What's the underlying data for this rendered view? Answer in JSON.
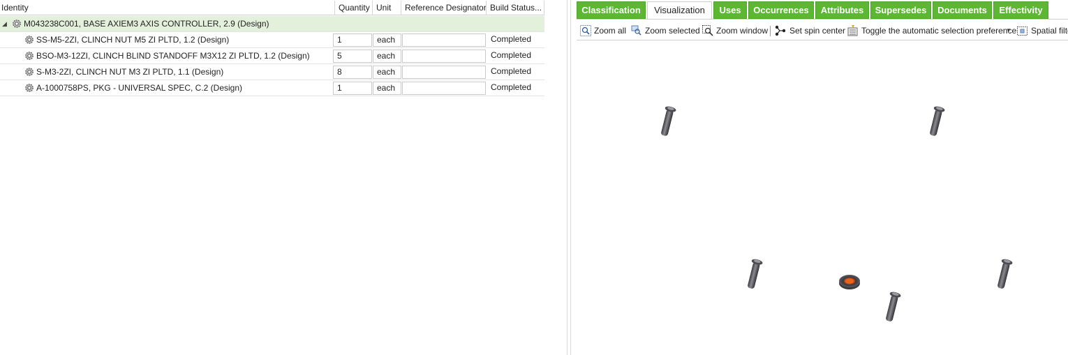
{
  "grid": {
    "columns": [
      "Identity",
      "Quantity",
      "Unit",
      "Reference Designator",
      "Build Status..."
    ],
    "rows": [
      {
        "identity": "M043238C001, BASE AXIEM3 AXIS CONTROLLER, 2.9 (Design)",
        "quantity": "",
        "unit": "",
        "ref": "",
        "status": ""
      },
      {
        "identity": "SS-M5-2ZI, CLINCH NUT M5 ZI PLTD, 1.2 (Design)",
        "quantity": "1",
        "unit": "each",
        "ref": "",
        "status": "Completed"
      },
      {
        "identity": "BSO-M3-12ZI, CLINCH BLIND STANDOFF M3X12 ZI PLTD, 1.2 (Design)",
        "quantity": "5",
        "unit": "each",
        "ref": "",
        "status": "Completed"
      },
      {
        "identity": "S-M3-2ZI, CLINCH NUT M3 ZI PLTD, 1.1 (Design)",
        "quantity": "8",
        "unit": "each",
        "ref": "",
        "status": "Completed"
      },
      {
        "identity": "A-1000758PS, PKG - UNIVERSAL SPEC, C.2 (Design)",
        "quantity": "1",
        "unit": "each",
        "ref": "",
        "status": "Completed"
      }
    ]
  },
  "tabs": [
    "Classification",
    "Visualization",
    "Uses",
    "Occurrences",
    "Attributes",
    "Supersedes",
    "Documents",
    "Effectivity"
  ],
  "active_tab": "Visualization",
  "toolbar": {
    "zoom_all": "Zoom all",
    "zoom_selected": "Zoom selected",
    "zoom_window": "Zoom window",
    "set_spin_center": "Set spin center",
    "toggle_selection": "Toggle the automatic selection preference",
    "spatial_filter": "Spatial filte"
  },
  "colors": {
    "tab_green": "#5cb832",
    "parent_row": "#e3f1dc",
    "part_gray": "#5a5a5f",
    "nut_orange": "#e8641e"
  },
  "icons": [
    "gear-icon",
    "zoom-all-icon",
    "zoom-selected-icon",
    "zoom-window-icon",
    "spin-center-icon",
    "selection-toggle-icon",
    "spatial-filter-icon",
    "dropdown-arrow-icon"
  ]
}
